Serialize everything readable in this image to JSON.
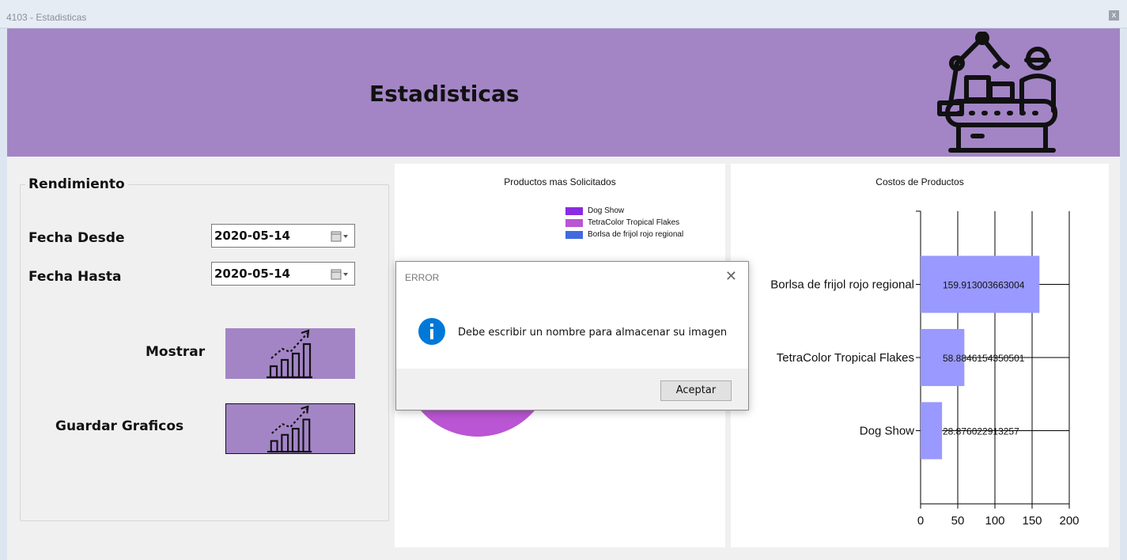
{
  "window": {
    "title": "4103 - Estadisticas",
    "close_label": "x"
  },
  "header": {
    "title": "Estadisticas",
    "logo_icon": "factory-assembly-line-icon"
  },
  "rendimiento": {
    "group_title": "Rendimiento",
    "fecha_desde_label": "Fecha Desde",
    "fecha_desde_value": "2020-05-14",
    "fecha_hasta_label": "Fecha Hasta",
    "fecha_hasta_value": "2020-05-14",
    "mostrar_label": "Mostrar",
    "guardar_label": "Guardar Graficos",
    "button_icon": "growth-chart-icon"
  },
  "pie_chart": {
    "title": "Productos mas Solicitados",
    "legend": [
      {
        "name": "Dog Show",
        "color": "#8a2be2"
      },
      {
        "name": "TetraColor Tropical Flakes",
        "color": "#ba55d3"
      },
      {
        "name": "Borlsa de frijol rojo regional",
        "color": "#4169e1"
      }
    ]
  },
  "chart_data": {
    "type": "bar",
    "orientation": "horizontal",
    "title": "Costos de Productos",
    "categories": [
      "Borlsa de frijol rojo regional",
      "TetraColor Tropical Flakes",
      "Dog Show"
    ],
    "values": [
      159.913003663004,
      58.8846154350501,
      28.876022913257
    ],
    "value_labels": [
      "159.913003663004",
      "58.8846154350501",
      "28.876022913257"
    ],
    "xlim": [
      0,
      200
    ],
    "xticks": [
      "0",
      "50",
      "100",
      "150",
      "200"
    ],
    "grid": true,
    "bar_color": "#9999ff"
  },
  "dialog": {
    "title": "ERROR",
    "close_label": "✕",
    "message": "Debe escribir un nombre para almacenar su imagen",
    "ok_label": "Aceptar",
    "icon": "info-icon"
  },
  "colors": {
    "accent": "#a385c6",
    "info_blue": "#0078d7"
  }
}
